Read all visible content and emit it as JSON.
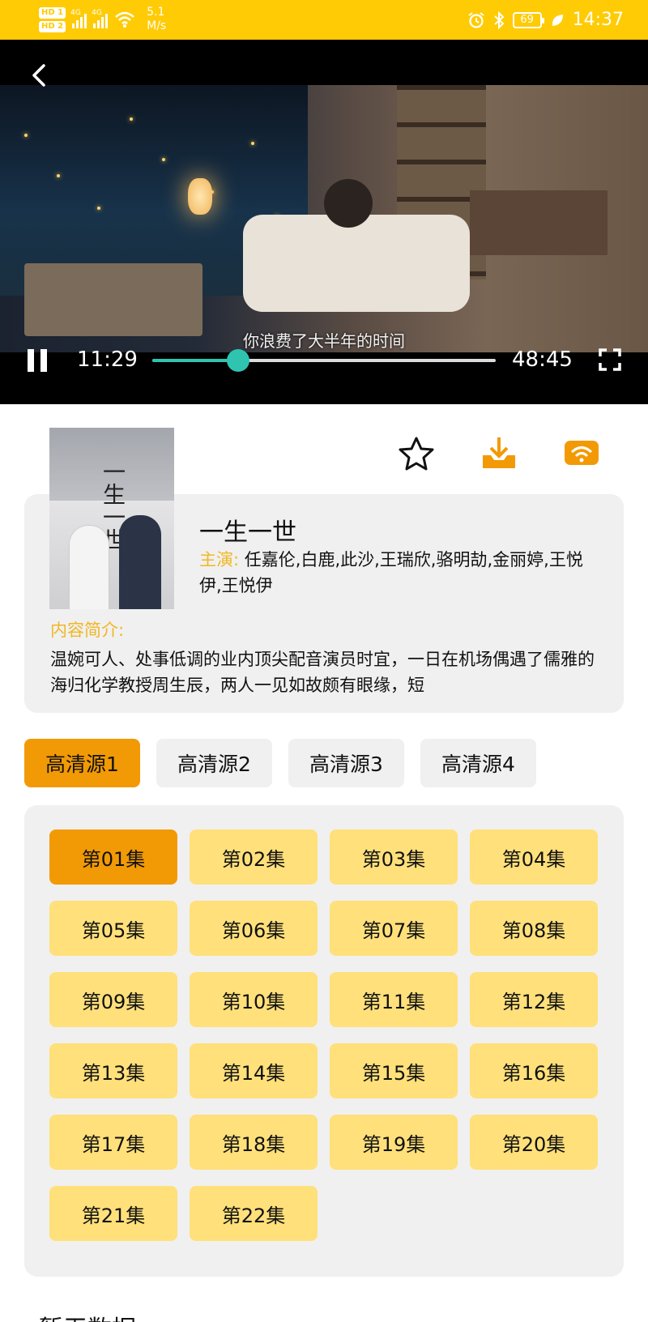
{
  "status_bar": {
    "hd1": "HD 1",
    "hd2": "HD 2",
    "net1": "4G",
    "net2": "4G",
    "speed_value": "5.1",
    "speed_unit": "M/s",
    "battery": "69",
    "time": "14:37"
  },
  "player": {
    "subtitle": "你浪费了大半年的时间",
    "current_time": "11:29",
    "total_time": "48:45",
    "progress": 0.25
  },
  "detail": {
    "title": "一生一世",
    "cast_label": "主演:",
    "cast": "任嘉伦,白鹿,此沙,王瑞欣,骆明劼,金丽婷,王悦伊,王悦伊",
    "intro_label": "内容简介:",
    "intro": "温婉可人、处事低调的业内顶尖配音演员时宜，一日在机场偶遇了儒雅的海归化学教授周生辰，两人一见如故颇有眼缘，短"
  },
  "sources": [
    "高清源1",
    "高清源2",
    "高清源3",
    "高清源4"
  ],
  "selected_source": 0,
  "episodes": [
    "第01集",
    "第02集",
    "第03集",
    "第04集",
    "第05集",
    "第06集",
    "第07集",
    "第08集",
    "第09集",
    "第10集",
    "第11集",
    "第12集",
    "第13集",
    "第14集",
    "第15集",
    "第16集",
    "第17集",
    "第18集",
    "第19集",
    "第20集",
    "第21集",
    "第22集"
  ],
  "selected_episode": 0,
  "section_title": "暂无数据",
  "colors": {
    "status_bar": "#ffcb05",
    "accent_orange": "#f29a05",
    "episode_yellow": "#ffe07a",
    "progress_teal": "#2ec4b0",
    "label_gold": "#f2b722"
  }
}
